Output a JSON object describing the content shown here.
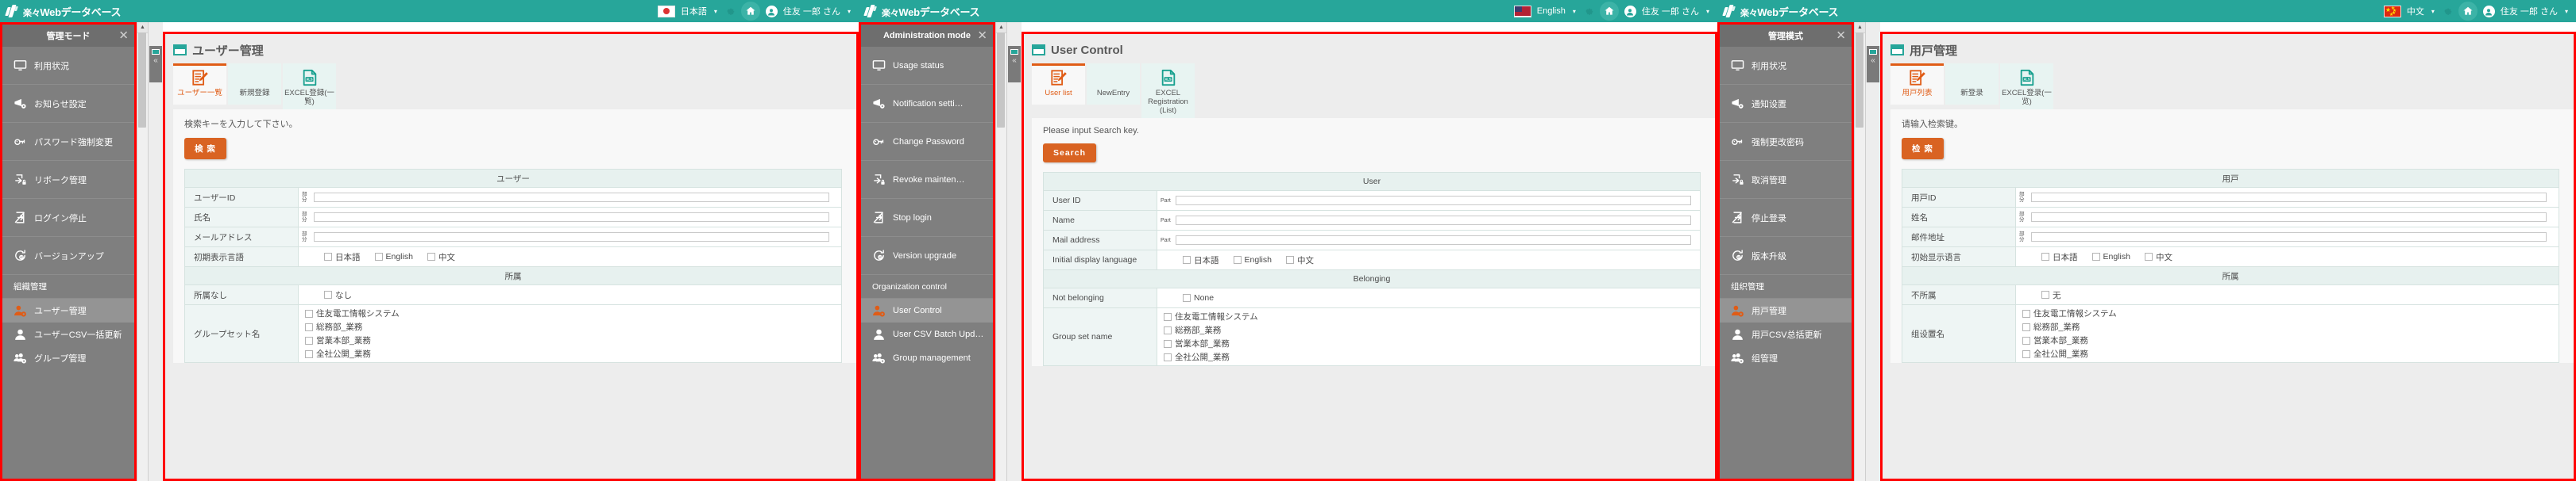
{
  "brand": {
    "text_kanji": "楽々",
    "text_main": "Webデータベース"
  },
  "panels": [
    {
      "id": "japanese",
      "header": {
        "flag": "jp-flag-icon",
        "language_label": "日本語",
        "gear_icon": "gear-icon",
        "home_icon": "home-icon",
        "avatar_icon": "avatar-icon",
        "user_name": "住友 一郎 さん"
      },
      "sidebar": {
        "title": "管理モード",
        "close_icon": "close-icon",
        "items": [
          {
            "label": "利用状況",
            "icon": "monitor-icon"
          },
          {
            "label": "お知らせ設定",
            "icon": "megaphone-gear-icon"
          },
          {
            "label": "パスワード強制変更",
            "icon": "key-icon"
          },
          {
            "label": "リボーク管理",
            "icon": "revoke-lock-icon"
          },
          {
            "label": "ログイン停止",
            "icon": "login-stop-icon"
          },
          {
            "label": "バージョンアップ",
            "icon": "version-up-icon"
          }
        ],
        "group_title": "組織管理",
        "group_items": [
          {
            "label": "ユーザー管理",
            "icon": "user-gear-icon",
            "active": true
          },
          {
            "label": "ユーザーCSV一括更新",
            "icon": "user-icon",
            "active": false
          },
          {
            "label": "グループ管理",
            "icon": "group-gear-icon",
            "active": false
          }
        ]
      },
      "main": {
        "page_title": "ユーザー管理",
        "page_title_icon": "window-icon",
        "tabs": [
          {
            "label": "ユーザー一覧",
            "icon": "list-edit-icon",
            "active": true
          },
          {
            "label": "新規登録",
            "icon": "new-entry-icon",
            "active": false
          },
          {
            "label": "EXCEL登録(一覧)",
            "icon": "xls-icon",
            "active": false
          }
        ],
        "hint": "検索キーを入力して下さい。",
        "search_button": "検 索",
        "section_user": "ユーザー",
        "section_belonging": "所属",
        "fields": [
          {
            "label": "ユーザーID",
            "type": "text",
            "prefix": "部分",
            "value": ""
          },
          {
            "label": "氏名",
            "type": "text",
            "prefix": "部分",
            "value": ""
          },
          {
            "label": "メールアドレス",
            "type": "text",
            "prefix": "部分",
            "value": ""
          },
          {
            "label": "初期表示言語",
            "type": "checks",
            "options": [
              "日本語",
              "English",
              "中文"
            ]
          }
        ],
        "belonging_fields": [
          {
            "label": "所属なし",
            "type": "checks",
            "options": [
              "なし"
            ]
          },
          {
            "label": "グループセット名",
            "type": "checklist",
            "options": [
              "住友電工情報システム",
              "総務部_業務",
              "営業本部_業務",
              "全社公開_業務"
            ]
          }
        ]
      }
    },
    {
      "id": "english",
      "header": {
        "flag": "us-flag-icon",
        "language_label": "English",
        "gear_icon": "gear-icon",
        "home_icon": "home-icon",
        "avatar_icon": "avatar-icon",
        "user_name": "住友 一郎 さん"
      },
      "sidebar": {
        "title": "Administration mode",
        "close_icon": "close-icon",
        "items": [
          {
            "label": "Usage status",
            "icon": "monitor-icon"
          },
          {
            "label": "Notification setti…",
            "icon": "megaphone-gear-icon"
          },
          {
            "label": "Change Password",
            "icon": "key-icon"
          },
          {
            "label": "Revoke mainten…",
            "icon": "revoke-lock-icon"
          },
          {
            "label": "Stop login",
            "icon": "login-stop-icon"
          },
          {
            "label": "Version upgrade",
            "icon": "version-up-icon"
          }
        ],
        "group_title": "Organization control",
        "group_items": [
          {
            "label": "User Control",
            "icon": "user-gear-icon",
            "active": true
          },
          {
            "label": "User CSV Batch Upd…",
            "icon": "user-icon",
            "active": false
          },
          {
            "label": "Group management",
            "icon": "group-gear-icon",
            "active": false
          }
        ]
      },
      "main": {
        "page_title": "User Control",
        "page_title_icon": "window-icon",
        "tabs": [
          {
            "label": "User list",
            "icon": "list-edit-icon",
            "active": true
          },
          {
            "label": "NewEntry",
            "icon": "new-entry-icon",
            "active": false
          },
          {
            "label": "EXCEL Registration (List)",
            "icon": "xls-icon",
            "active": false
          }
        ],
        "hint": "Please input Search key.",
        "search_button": "Search",
        "section_user": "User",
        "section_belonging": "Belonging",
        "fields": [
          {
            "label": "User ID",
            "type": "text",
            "prefix": "Part",
            "value": ""
          },
          {
            "label": "Name",
            "type": "text",
            "prefix": "Part",
            "value": ""
          },
          {
            "label": "Mail address",
            "type": "text",
            "prefix": "Part",
            "value": ""
          },
          {
            "label": "Initial display language",
            "type": "checks",
            "options": [
              "日本語",
              "English",
              "中文"
            ]
          }
        ],
        "belonging_fields": [
          {
            "label": "Not belonging",
            "type": "checks",
            "options": [
              "None"
            ]
          },
          {
            "label": "Group set name",
            "type": "checklist",
            "options": [
              "住友電工情報システム",
              "総務部_業務",
              "営業本部_業務",
              "全社公開_業務"
            ]
          }
        ]
      }
    },
    {
      "id": "chinese",
      "header": {
        "flag": "cn-flag-icon",
        "language_label": "中文",
        "gear_icon": "gear-icon",
        "home_icon": "home-icon",
        "avatar_icon": "avatar-icon",
        "user_name": "住友 一郎 さん"
      },
      "sidebar": {
        "title": "管理模式",
        "close_icon": "close-icon",
        "items": [
          {
            "label": "利用状况",
            "icon": "monitor-icon"
          },
          {
            "label": "通知设置",
            "icon": "megaphone-gear-icon"
          },
          {
            "label": "强制更改密码",
            "icon": "key-icon"
          },
          {
            "label": "取消管理",
            "icon": "revoke-lock-icon"
          },
          {
            "label": "停止登录",
            "icon": "login-stop-icon"
          },
          {
            "label": "版本升级",
            "icon": "version-up-icon"
          }
        ],
        "group_title": "组织管理",
        "group_items": [
          {
            "label": "用户管理",
            "icon": "user-gear-icon",
            "active": true
          },
          {
            "label": "用户CSV总括更新",
            "icon": "user-icon",
            "active": false
          },
          {
            "label": "组管理",
            "icon": "group-gear-icon",
            "active": false
          }
        ]
      },
      "main": {
        "page_title": "用户管理",
        "page_title_icon": "window-icon",
        "tabs": [
          {
            "label": "用户列表",
            "icon": "list-edit-icon",
            "active": true
          },
          {
            "label": "新登录",
            "icon": "new-entry-icon",
            "active": false
          },
          {
            "label": "EXCEL登录(一览)",
            "icon": "xls-icon",
            "active": false
          }
        ],
        "hint": "请输入检索键。",
        "search_button": "检 索",
        "section_user": "用户",
        "section_belonging": "所属",
        "fields": [
          {
            "label": "用户ID",
            "type": "text",
            "prefix": "部分",
            "value": ""
          },
          {
            "label": "姓名",
            "type": "text",
            "prefix": "部分",
            "value": ""
          },
          {
            "label": "邮件地址",
            "type": "text",
            "prefix": "部分",
            "value": ""
          },
          {
            "label": "初始显示语言",
            "type": "checks",
            "options": [
              "日本語",
              "English",
              "中文"
            ]
          }
        ],
        "belonging_fields": [
          {
            "label": "不所属",
            "type": "checks",
            "options": [
              "无"
            ]
          },
          {
            "label": "组设置名",
            "type": "checklist",
            "options": [
              "住友電工情報システム",
              "総務部_業務",
              "営業本部_業務",
              "全社公開_業務"
            ]
          }
        ]
      }
    }
  ],
  "colors": {
    "brand_teal": "#27a69a",
    "accent_orange": "#e05c16",
    "search_orange": "#d96322",
    "sidebar_gray": "#7f7f7f",
    "annotation_red": "#ff0000"
  }
}
